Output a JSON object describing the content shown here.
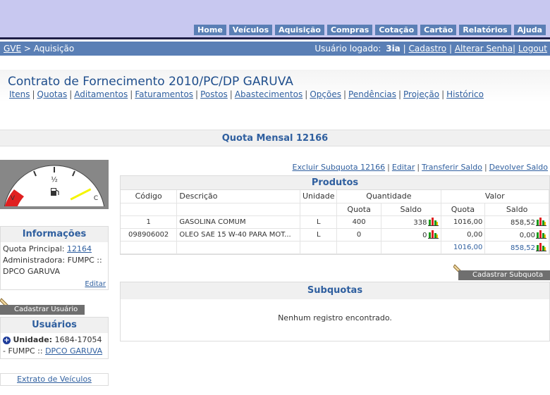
{
  "nav": [
    "Home",
    "Veículos",
    "Aquisição",
    "Compras",
    "Cotação",
    "Cartão",
    "Relatórios",
    "Ajuda"
  ],
  "breadcrumb": {
    "root": "GVE",
    "separator": " > ",
    "current": "Aquisição"
  },
  "user": {
    "label": "Usuário logado:",
    "name": "3ia",
    "links": [
      "Cadastro",
      "Alterar Senha",
      "Logout"
    ]
  },
  "contract": {
    "title": "Contrato de Fornecimento 2010/PC/DP GARUVA",
    "tabs": [
      "Itens",
      "Quotas",
      "Aditamentos",
      "Faturamentos",
      "Postos",
      "Abastecimentos",
      "Opções",
      "Pendências",
      "Projeção",
      "Histórico"
    ]
  },
  "quota": {
    "title": "Quota Mensal 12166"
  },
  "gauge": {
    "empty_label": "V",
    "half_label": "½",
    "full_label": "C",
    "needle_level": 0.85,
    "colors": {
      "low": "#e02020",
      "needle": "#f5f500"
    }
  },
  "info": {
    "title": "Informações",
    "quota_principal_label": "Quota Principal:",
    "quota_principal_value": "12164",
    "administradora_label": "Administradora:",
    "administradora_value": "FUMPC :: DPCO GARUVA",
    "edit": "Editar"
  },
  "cadastrar_usuario": "Cadastrar Usuário",
  "usuarios": {
    "title": "Usuários",
    "unidade_label": "Unidade:",
    "unidade_value": "1684-17054 - FUMPC ::",
    "unidade_link": "DPCO GARUVA"
  },
  "extrato": "Extrato de Veículos",
  "actions": [
    "Excluir Subquota 12166",
    "Editar",
    "Transferir Saldo",
    "Devolver Saldo"
  ],
  "produtos": {
    "title": "Produtos",
    "headers": {
      "codigo": "Código",
      "descricao": "Descrição",
      "unidade": "Unidade",
      "quantidade": "Quantidade",
      "valor": "Valor",
      "quota": "Quota",
      "saldo": "Saldo"
    },
    "rows": [
      {
        "codigo": "1",
        "descricao": "GASOLINA COMUM",
        "unidade": "L",
        "q_quota": "400",
        "q_saldo": "338",
        "v_quota": "1016,00",
        "v_saldo": "858,52"
      },
      {
        "codigo": "098906002",
        "descricao": "OLEO SAE 15 W-40 PARA MOT...",
        "unidade": "L",
        "q_quota": "0",
        "q_saldo": "0",
        "v_quota": "0,00",
        "v_saldo": "0,00"
      }
    ],
    "totals": {
      "v_quota": "1016,00",
      "v_saldo": "858,52"
    }
  },
  "cadastrar_subquota": "Cadastrar Subquota",
  "subquotas": {
    "title": "Subquotas",
    "empty": "Nenhum registro encontrado."
  }
}
